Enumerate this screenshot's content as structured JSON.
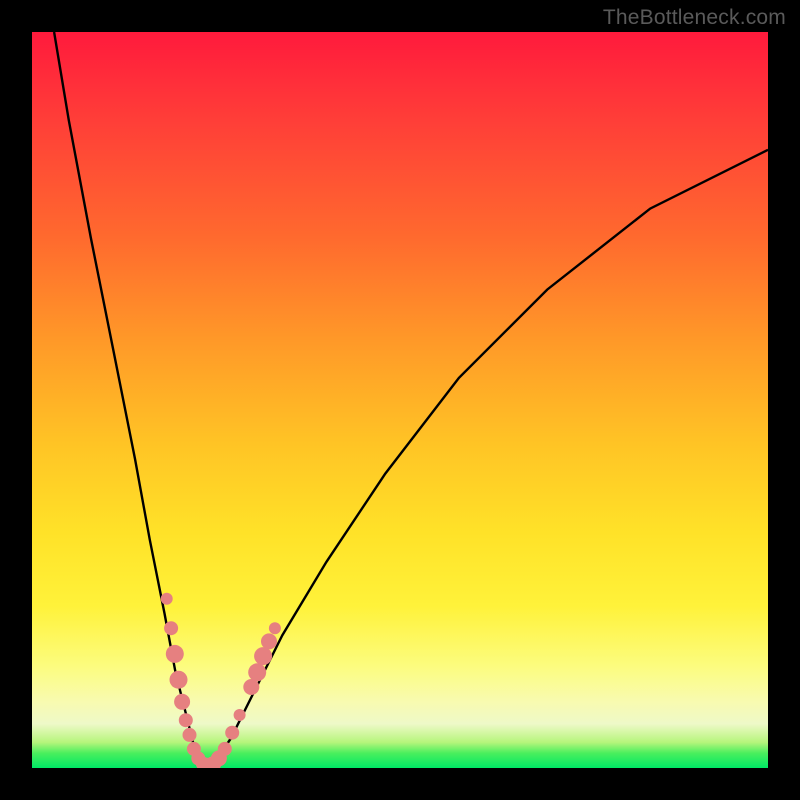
{
  "watermark": "TheBottleneck.com",
  "chart_data": {
    "type": "line",
    "title": "",
    "xlabel": "",
    "ylabel": "",
    "xlim": [
      0,
      100
    ],
    "ylim": [
      0,
      100
    ],
    "series": [
      {
        "name": "bottleneck-curve",
        "x": [
          3,
          5,
          8,
          11,
          14,
          16,
          18,
          19.5,
          21,
          22,
          23,
          24,
          25,
          27,
          30,
          34,
          40,
          48,
          58,
          70,
          84,
          100
        ],
        "y": [
          100,
          88,
          72,
          57,
          42,
          31,
          21,
          13,
          7,
          3,
          1,
          0.5,
          1,
          4,
          10,
          18,
          28,
          40,
          53,
          65,
          76,
          84
        ]
      }
    ],
    "markers": {
      "name": "sample-points",
      "color": "#e68080",
      "points": [
        {
          "x": 18.3,
          "y": 23.0,
          "r": 6
        },
        {
          "x": 18.9,
          "y": 19.0,
          "r": 7
        },
        {
          "x": 19.4,
          "y": 15.5,
          "r": 9
        },
        {
          "x": 19.9,
          "y": 12.0,
          "r": 9
        },
        {
          "x": 20.4,
          "y": 9.0,
          "r": 8
        },
        {
          "x": 20.9,
          "y": 6.5,
          "r": 7
        },
        {
          "x": 21.4,
          "y": 4.5,
          "r": 7
        },
        {
          "x": 22.0,
          "y": 2.6,
          "r": 7
        },
        {
          "x": 22.6,
          "y": 1.3,
          "r": 7
        },
        {
          "x": 23.2,
          "y": 0.6,
          "r": 7
        },
        {
          "x": 23.8,
          "y": 0.3,
          "r": 8
        },
        {
          "x": 24.6,
          "y": 0.5,
          "r": 8
        },
        {
          "x": 25.4,
          "y": 1.3,
          "r": 8
        },
        {
          "x": 26.2,
          "y": 2.6,
          "r": 7
        },
        {
          "x": 27.2,
          "y": 4.8,
          "r": 7
        },
        {
          "x": 28.2,
          "y": 7.2,
          "r": 6
        },
        {
          "x": 29.8,
          "y": 11.0,
          "r": 8
        },
        {
          "x": 30.6,
          "y": 13.0,
          "r": 9
        },
        {
          "x": 31.4,
          "y": 15.2,
          "r": 9
        },
        {
          "x": 32.2,
          "y": 17.2,
          "r": 8
        },
        {
          "x": 33.0,
          "y": 19.0,
          "r": 6
        }
      ]
    }
  }
}
